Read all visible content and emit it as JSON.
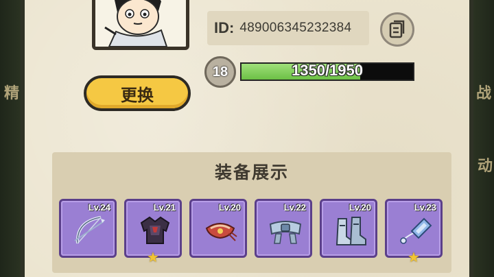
{
  "profile": {
    "id_label": "ID:",
    "id_value": "489006345232384",
    "level": "18",
    "xp_text": "1350/1950",
    "xp_fraction": 0.692,
    "change_button_label": "更换"
  },
  "equipment": {
    "title": "装备展示",
    "items": [
      {
        "level": "Lv.24",
        "icon": "bow-icon",
        "star": false
      },
      {
        "level": "Lv.21",
        "icon": "armor-icon",
        "star": true
      },
      {
        "level": "Lv.20",
        "icon": "headband-icon",
        "star": false
      },
      {
        "level": "Lv.22",
        "icon": "belt-icon",
        "star": false
      },
      {
        "level": "Lv.20",
        "icon": "boots-icon",
        "star": false
      },
      {
        "level": "Lv.23",
        "icon": "amulet-icon",
        "star": true
      }
    ],
    "star_glyph": "★"
  },
  "background_glyphs": {
    "left": "精",
    "right": "战",
    "right_bottom": "动"
  },
  "colors": {
    "xp_fill": "#6cc045",
    "button": "#f5c843",
    "slot": "#9a7fd3",
    "star": "#f3c531"
  }
}
